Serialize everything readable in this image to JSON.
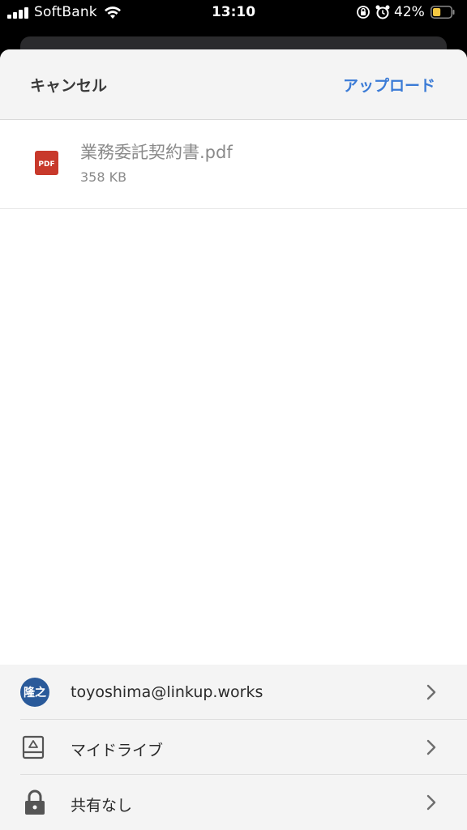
{
  "status_bar": {
    "carrier": "SoftBank",
    "time": "13:10",
    "battery_percent": "42%",
    "battery_level": 0.42,
    "icons": [
      "signal-icon",
      "wifi-icon",
      "rotation-lock-icon",
      "alarm-icon",
      "battery-icon"
    ]
  },
  "header": {
    "cancel_label": "キャンセル",
    "upload_label": "アップロード"
  },
  "file": {
    "name": "業務委託契約書.pdf",
    "size": "358 KB",
    "icon_label": "PDF"
  },
  "destination": {
    "account": {
      "avatar_text": "隆之",
      "email": "toyoshima@linkup.works"
    },
    "drive": {
      "label": "マイドライブ"
    },
    "sharing": {
      "label": "共有なし"
    }
  },
  "colors": {
    "accent": "#3b7bd6",
    "pdf_red": "#c8392b",
    "avatar_bg": "#2a5a9a"
  }
}
